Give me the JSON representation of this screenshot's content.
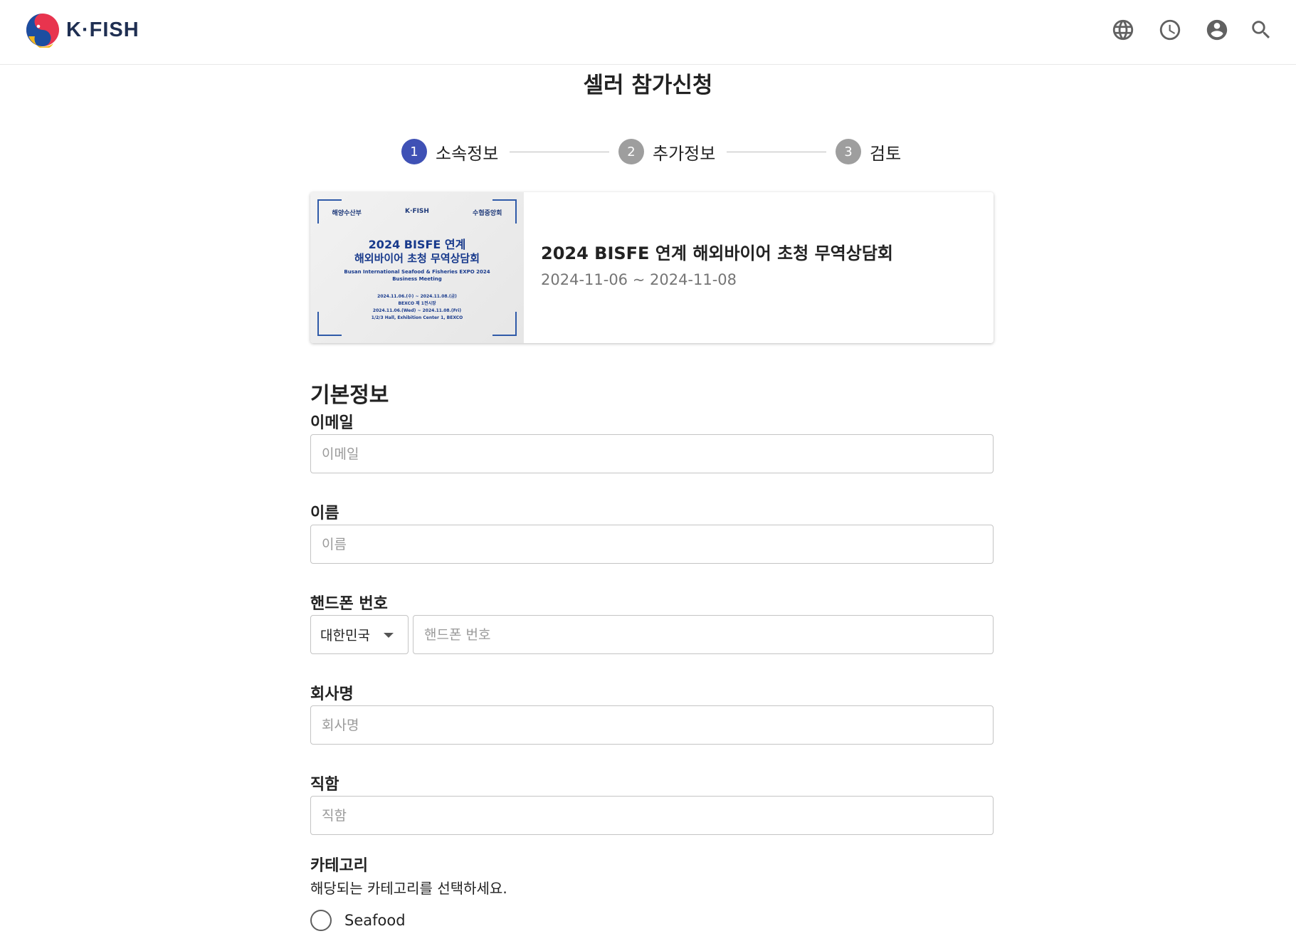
{
  "header": {
    "logo_text": "K·FISH",
    "icons": [
      "globe-icon",
      "clock-icon",
      "account-icon",
      "search-icon"
    ]
  },
  "page": {
    "title": "셀러 참가신청"
  },
  "stepper": {
    "steps": [
      {
        "number": "1",
        "label": "소속정보",
        "state": "active"
      },
      {
        "number": "2",
        "label": "추가정보",
        "state": "inactive"
      },
      {
        "number": "3",
        "label": "검토",
        "state": "inactive"
      }
    ]
  },
  "event": {
    "name": "2024 BISFE 연계 해외바이어 초청 무역상담회",
    "dates": "2024-11-06 ~ 2024-11-08",
    "poster": {
      "logo_left": "해양수산부",
      "logo_center": "K·FISH",
      "logo_right": "수협중앙회",
      "title_line1": "2024 BISFE 연계",
      "title_line2": "해외바이어 초청 무역상담회",
      "subtitle_line1": "Busan International Seafood & Fisheries EXPO 2024",
      "subtitle_line2": "Business Meeting",
      "date_line1": "2024.11.06.(수) ~ 2024.11.08.(금)",
      "date_line2": "BEXCO 제 1전시장",
      "date_line3": "2024.11.06.(Wed) ~ 2024.11.08.(Fri)",
      "date_line4": "1/2/3 Hall, Exhibition Center 1, BEXCO"
    }
  },
  "form": {
    "section_title": "기본정보",
    "email": {
      "label": "이메일",
      "placeholder": "이메일",
      "value": ""
    },
    "name": {
      "label": "이름",
      "placeholder": "이름",
      "value": ""
    },
    "phone": {
      "label": "핸드폰 번호",
      "country": "대한민국",
      "placeholder": "핸드폰 번호",
      "value": ""
    },
    "company": {
      "label": "회사명",
      "placeholder": "회사명",
      "value": ""
    },
    "position": {
      "label": "직함",
      "placeholder": "직함",
      "value": ""
    },
    "category": {
      "label": "카테고리",
      "description": "해당되는 카테고리를 선택하세요.",
      "options": [
        {
          "label": "Seafood",
          "selected": false
        }
      ]
    }
  },
  "colors": {
    "accent": "#3f51b5",
    "inactive_step": "#9e9e9e",
    "icon": "#616161"
  }
}
